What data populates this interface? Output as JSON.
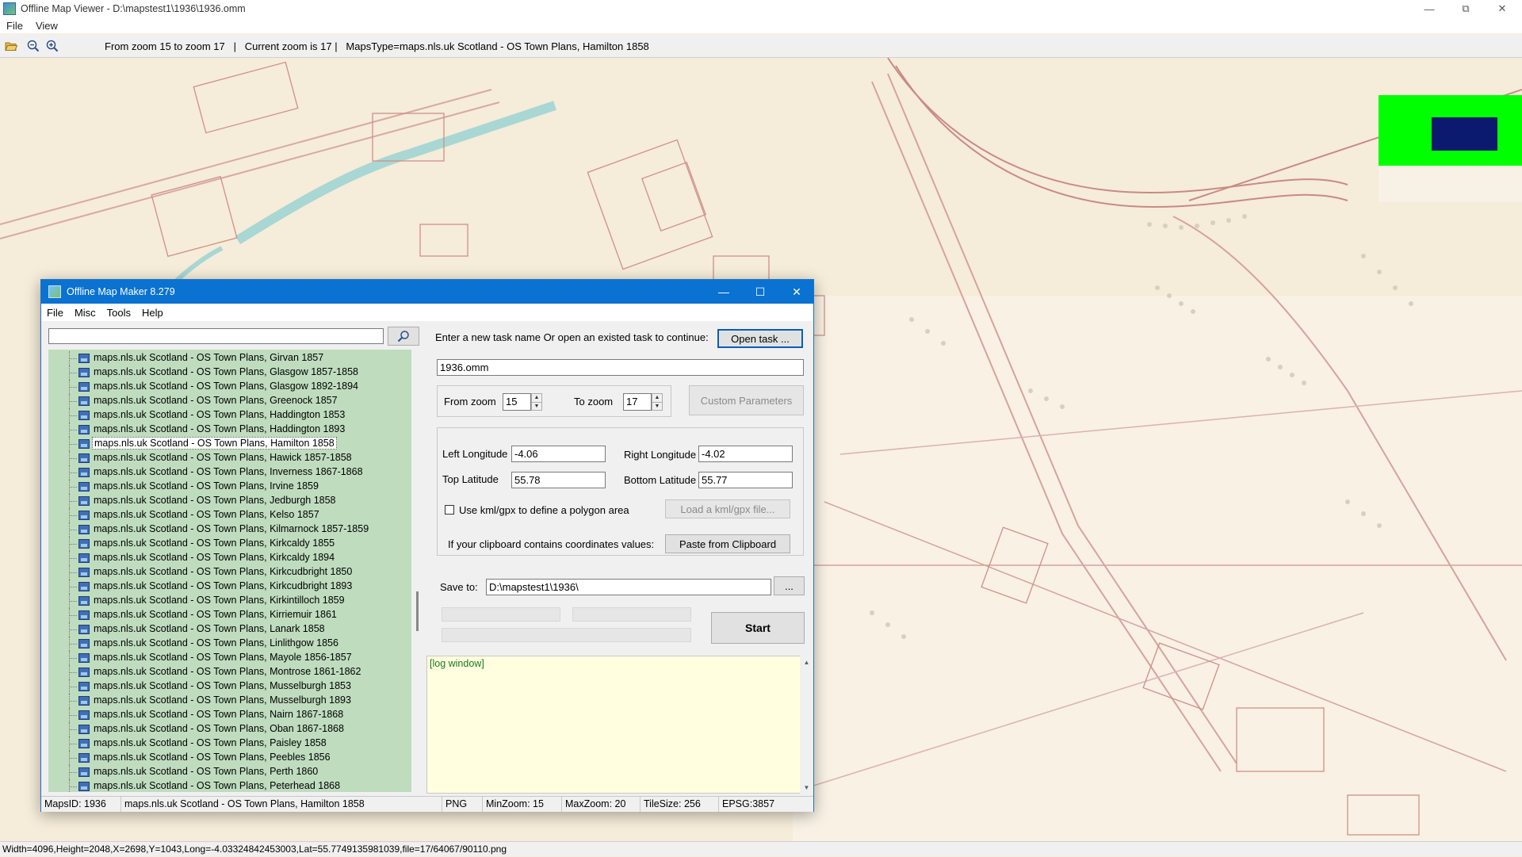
{
  "viewer": {
    "title": "Offline Map Viewer - D:\\mapstest1\\1936\\1936.omm",
    "menu": [
      "File",
      "View"
    ],
    "toolbar_text": "From zoom 15 to zoom 17   |   Current zoom is 17 |   MapsType=maps.nls.uk Scotland - OS Town Plans, Hamilton 1858",
    "statusbar": "Width=4096,Height=2048,X=2698,Y=1043,Long=-4.03324842453003,Lat=55.7749135981039,file=17/64067/90110.png",
    "icons": {
      "open": "folder-open-icon",
      "zoom_out": "zoom-out-icon",
      "zoom_in": "zoom-in-icon"
    }
  },
  "dialog": {
    "title": "Offline Map Maker 8.279",
    "menu": [
      "File",
      "Misc",
      "Tools",
      "Help"
    ],
    "search": {
      "value": "",
      "placeholder": ""
    },
    "list": [
      "maps.nls.uk Scotland - OS Town Plans, Girvan 1857",
      "maps.nls.uk Scotland - OS Town Plans, Glasgow 1857-1858",
      "maps.nls.uk Scotland - OS Town Plans, Glasgow 1892-1894",
      "maps.nls.uk Scotland - OS Town Plans, Greenock 1857",
      "maps.nls.uk Scotland - OS Town Plans, Haddington 1853",
      "maps.nls.uk Scotland - OS Town Plans, Haddington 1893",
      "maps.nls.uk Scotland - OS Town Plans, Hamilton 1858",
      "maps.nls.uk Scotland - OS Town Plans, Hawick 1857-1858",
      "maps.nls.uk Scotland - OS Town Plans, Inverness 1867-1868",
      "maps.nls.uk Scotland - OS Town Plans, Irvine 1859",
      "maps.nls.uk Scotland - OS Town Plans, Jedburgh 1858",
      "maps.nls.uk Scotland - OS Town Plans, Kelso 1857",
      "maps.nls.uk Scotland - OS Town Plans, Kilmarnock 1857-1859",
      "maps.nls.uk Scotland - OS Town Plans, Kirkcaldy 1855",
      "maps.nls.uk Scotland - OS Town Plans, Kirkcaldy 1894",
      "maps.nls.uk Scotland - OS Town Plans, Kirkcudbright 1850",
      "maps.nls.uk Scotland - OS Town Plans, Kirkcudbright 1893",
      "maps.nls.uk Scotland - OS Town Plans, Kirkintilloch 1859",
      "maps.nls.uk Scotland - OS Town Plans, Kirriemuir 1861",
      "maps.nls.uk Scotland - OS Town Plans, Lanark 1858",
      "maps.nls.uk Scotland - OS Town Plans, Linlithgow 1856",
      "maps.nls.uk Scotland - OS Town Plans, Mayole 1856-1857",
      "maps.nls.uk Scotland - OS Town Plans, Montrose 1861-1862",
      "maps.nls.uk Scotland - OS Town Plans, Musselburgh 1853",
      "maps.nls.uk Scotland - OS Town Plans, Musselburgh 1893",
      "maps.nls.uk Scotland - OS Town Plans, Nairn 1867-1868",
      "maps.nls.uk Scotland - OS Town Plans, Oban 1867-1868",
      "maps.nls.uk Scotland - OS Town Plans, Paisley 1858",
      "maps.nls.uk Scotland - OS Town Plans, Peebles 1856",
      "maps.nls.uk Scotland - OS Town Plans, Perth 1860",
      "maps.nls.uk Scotland - OS Town Plans, Peterhead 1868"
    ],
    "selected_item": "maps.nls.uk Scotland - OS Town Plans, Hamilton 1858",
    "task_prompt": "Enter a new task name Or open an existed task to continue:",
    "open_task_label": "Open task ...",
    "task_name": "1936.omm",
    "from_zoom_label": "From zoom",
    "from_zoom": "15",
    "to_zoom_label": "To zoom",
    "to_zoom": "17",
    "custom_params_label": "Custom Parameters",
    "left_lon_label": "Left Longitude",
    "left_lon": "-4.06",
    "right_lon_label": "Right Longitude",
    "right_lon": "-4.02",
    "top_lat_label": "Top Latitude",
    "top_lat": "55.78",
    "bottom_lat_label": "Bottom Latitude",
    "bottom_lat": "55.77",
    "kml_checkbox_label": "Use kml/gpx to define a polygon area",
    "load_kml_label": "Load a kml/gpx file...",
    "clipboard_prompt": "If your clipboard contains coordinates values:",
    "paste_label": "Paste from Clipboard",
    "save_to_label": "Save to:",
    "save_to": "D:\\mapstest1\\1936\\",
    "browse_label": "...",
    "start_label": "Start",
    "log_text": "[log window]",
    "status": {
      "maps_id": "MapsID: 1936",
      "maps_name": "maps.nls.uk Scotland - OS Town Plans, Hamilton 1858",
      "format": "PNG",
      "min_zoom": "MinZoom: 15",
      "max_zoom": "MaxZoom: 20",
      "tile_size": "TileSize: 256",
      "epsg": "EPSG:3857"
    }
  },
  "colors": {
    "accent": "#0a72d1",
    "list_bg": "#bfdcbf",
    "log_bg": "#ffffe0",
    "minimap_bg": "#00ff00",
    "minimap_viewport": "#0b1a6e"
  }
}
